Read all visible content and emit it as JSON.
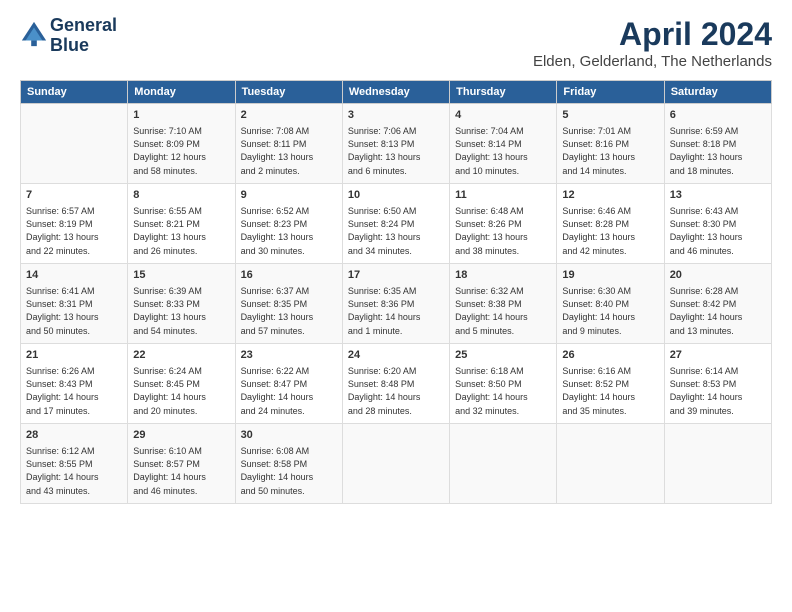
{
  "logo": {
    "line1": "General",
    "line2": "Blue"
  },
  "title": "April 2024",
  "location": "Elden, Gelderland, The Netherlands",
  "days_header": [
    "Sunday",
    "Monday",
    "Tuesday",
    "Wednesday",
    "Thursday",
    "Friday",
    "Saturday"
  ],
  "weeks": [
    [
      {
        "day": "",
        "content": ""
      },
      {
        "day": "1",
        "content": "Sunrise: 7:10 AM\nSunset: 8:09 PM\nDaylight: 12 hours\nand 58 minutes."
      },
      {
        "day": "2",
        "content": "Sunrise: 7:08 AM\nSunset: 8:11 PM\nDaylight: 13 hours\nand 2 minutes."
      },
      {
        "day": "3",
        "content": "Sunrise: 7:06 AM\nSunset: 8:13 PM\nDaylight: 13 hours\nand 6 minutes."
      },
      {
        "day": "4",
        "content": "Sunrise: 7:04 AM\nSunset: 8:14 PM\nDaylight: 13 hours\nand 10 minutes."
      },
      {
        "day": "5",
        "content": "Sunrise: 7:01 AM\nSunset: 8:16 PM\nDaylight: 13 hours\nand 14 minutes."
      },
      {
        "day": "6",
        "content": "Sunrise: 6:59 AM\nSunset: 8:18 PM\nDaylight: 13 hours\nand 18 minutes."
      }
    ],
    [
      {
        "day": "7",
        "content": "Sunrise: 6:57 AM\nSunset: 8:19 PM\nDaylight: 13 hours\nand 22 minutes."
      },
      {
        "day": "8",
        "content": "Sunrise: 6:55 AM\nSunset: 8:21 PM\nDaylight: 13 hours\nand 26 minutes."
      },
      {
        "day": "9",
        "content": "Sunrise: 6:52 AM\nSunset: 8:23 PM\nDaylight: 13 hours\nand 30 minutes."
      },
      {
        "day": "10",
        "content": "Sunrise: 6:50 AM\nSunset: 8:24 PM\nDaylight: 13 hours\nand 34 minutes."
      },
      {
        "day": "11",
        "content": "Sunrise: 6:48 AM\nSunset: 8:26 PM\nDaylight: 13 hours\nand 38 minutes."
      },
      {
        "day": "12",
        "content": "Sunrise: 6:46 AM\nSunset: 8:28 PM\nDaylight: 13 hours\nand 42 minutes."
      },
      {
        "day": "13",
        "content": "Sunrise: 6:43 AM\nSunset: 8:30 PM\nDaylight: 13 hours\nand 46 minutes."
      }
    ],
    [
      {
        "day": "14",
        "content": "Sunrise: 6:41 AM\nSunset: 8:31 PM\nDaylight: 13 hours\nand 50 minutes."
      },
      {
        "day": "15",
        "content": "Sunrise: 6:39 AM\nSunset: 8:33 PM\nDaylight: 13 hours\nand 54 minutes."
      },
      {
        "day": "16",
        "content": "Sunrise: 6:37 AM\nSunset: 8:35 PM\nDaylight: 13 hours\nand 57 minutes."
      },
      {
        "day": "17",
        "content": "Sunrise: 6:35 AM\nSunset: 8:36 PM\nDaylight: 14 hours\nand 1 minute."
      },
      {
        "day": "18",
        "content": "Sunrise: 6:32 AM\nSunset: 8:38 PM\nDaylight: 14 hours\nand 5 minutes."
      },
      {
        "day": "19",
        "content": "Sunrise: 6:30 AM\nSunset: 8:40 PM\nDaylight: 14 hours\nand 9 minutes."
      },
      {
        "day": "20",
        "content": "Sunrise: 6:28 AM\nSunset: 8:42 PM\nDaylight: 14 hours\nand 13 minutes."
      }
    ],
    [
      {
        "day": "21",
        "content": "Sunrise: 6:26 AM\nSunset: 8:43 PM\nDaylight: 14 hours\nand 17 minutes."
      },
      {
        "day": "22",
        "content": "Sunrise: 6:24 AM\nSunset: 8:45 PM\nDaylight: 14 hours\nand 20 minutes."
      },
      {
        "day": "23",
        "content": "Sunrise: 6:22 AM\nSunset: 8:47 PM\nDaylight: 14 hours\nand 24 minutes."
      },
      {
        "day": "24",
        "content": "Sunrise: 6:20 AM\nSunset: 8:48 PM\nDaylight: 14 hours\nand 28 minutes."
      },
      {
        "day": "25",
        "content": "Sunrise: 6:18 AM\nSunset: 8:50 PM\nDaylight: 14 hours\nand 32 minutes."
      },
      {
        "day": "26",
        "content": "Sunrise: 6:16 AM\nSunset: 8:52 PM\nDaylight: 14 hours\nand 35 minutes."
      },
      {
        "day": "27",
        "content": "Sunrise: 6:14 AM\nSunset: 8:53 PM\nDaylight: 14 hours\nand 39 minutes."
      }
    ],
    [
      {
        "day": "28",
        "content": "Sunrise: 6:12 AM\nSunset: 8:55 PM\nDaylight: 14 hours\nand 43 minutes."
      },
      {
        "day": "29",
        "content": "Sunrise: 6:10 AM\nSunset: 8:57 PM\nDaylight: 14 hours\nand 46 minutes."
      },
      {
        "day": "30",
        "content": "Sunrise: 6:08 AM\nSunset: 8:58 PM\nDaylight: 14 hours\nand 50 minutes."
      },
      {
        "day": "",
        "content": ""
      },
      {
        "day": "",
        "content": ""
      },
      {
        "day": "",
        "content": ""
      },
      {
        "day": "",
        "content": ""
      }
    ]
  ]
}
